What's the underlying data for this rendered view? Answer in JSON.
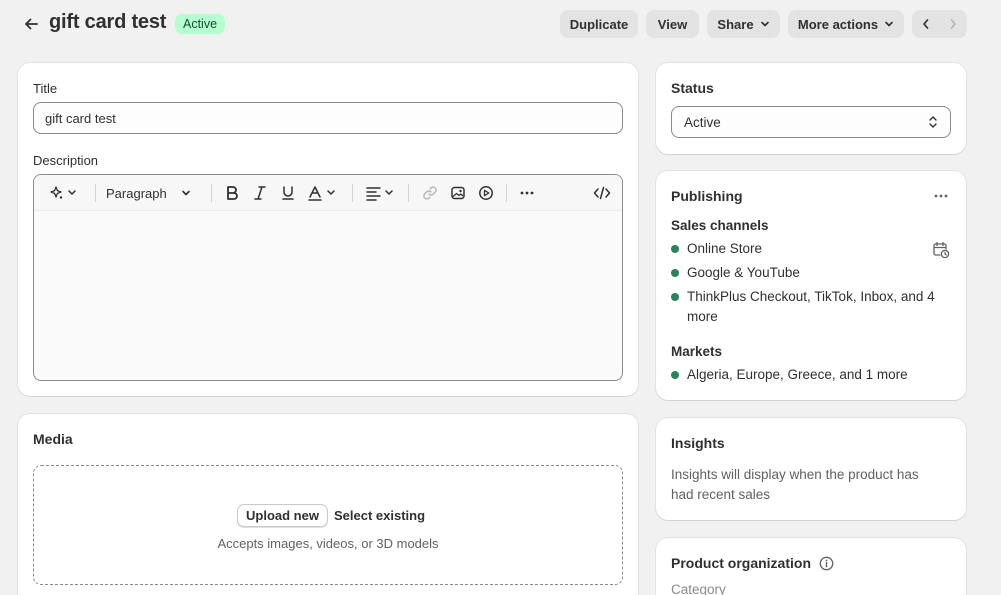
{
  "header": {
    "title": "gift card test",
    "status": "Active",
    "actions": {
      "duplicate": "Duplicate",
      "view": "View",
      "share": "Share",
      "more_actions": "More actions"
    },
    "icons": [
      "arrow-left-icon",
      "chevron-down-icon",
      "chevron-left-icon",
      "chevron-right-icon"
    ]
  },
  "main": {
    "title_label": "Title",
    "title_value": "gift card test",
    "description_label": "Description",
    "editor": {
      "paragraph_style": "Paragraph",
      "tools": [
        "magic-icon",
        "bold-icon",
        "italic-icon",
        "underline-icon",
        "text-color-icon",
        "align-icon",
        "link-icon",
        "image-icon",
        "video-icon",
        "more-icon",
        "code-icon"
      ]
    },
    "media": {
      "title": "Media",
      "upload_new": "Upload new",
      "select_existing": "Select existing",
      "accepts": "Accepts images, videos, or 3D models"
    }
  },
  "sidebar": {
    "status": {
      "title": "Status",
      "value": "Active"
    },
    "publishing": {
      "title": "Publishing",
      "sales_channels_label": "Sales channels",
      "channels": [
        "Online Store",
        "Google & YouTube",
        "ThinkPlus Checkout, TikTok, Inbox, and 4",
        "more"
      ],
      "markets_label": "Markets",
      "markets": "Algeria, Europe, Greece, and 1 more"
    },
    "insights": {
      "title": "Insights",
      "line1": "Insights will display when the product has",
      "line2": "had recent sales"
    },
    "organization": {
      "title": "Product organization",
      "category_label": "Category"
    }
  },
  "colors": {
    "background": "#f1f1f1",
    "badge_bg": "#b4fed2",
    "badge_text": "#0c5132",
    "channel_dot": "#29845a"
  }
}
